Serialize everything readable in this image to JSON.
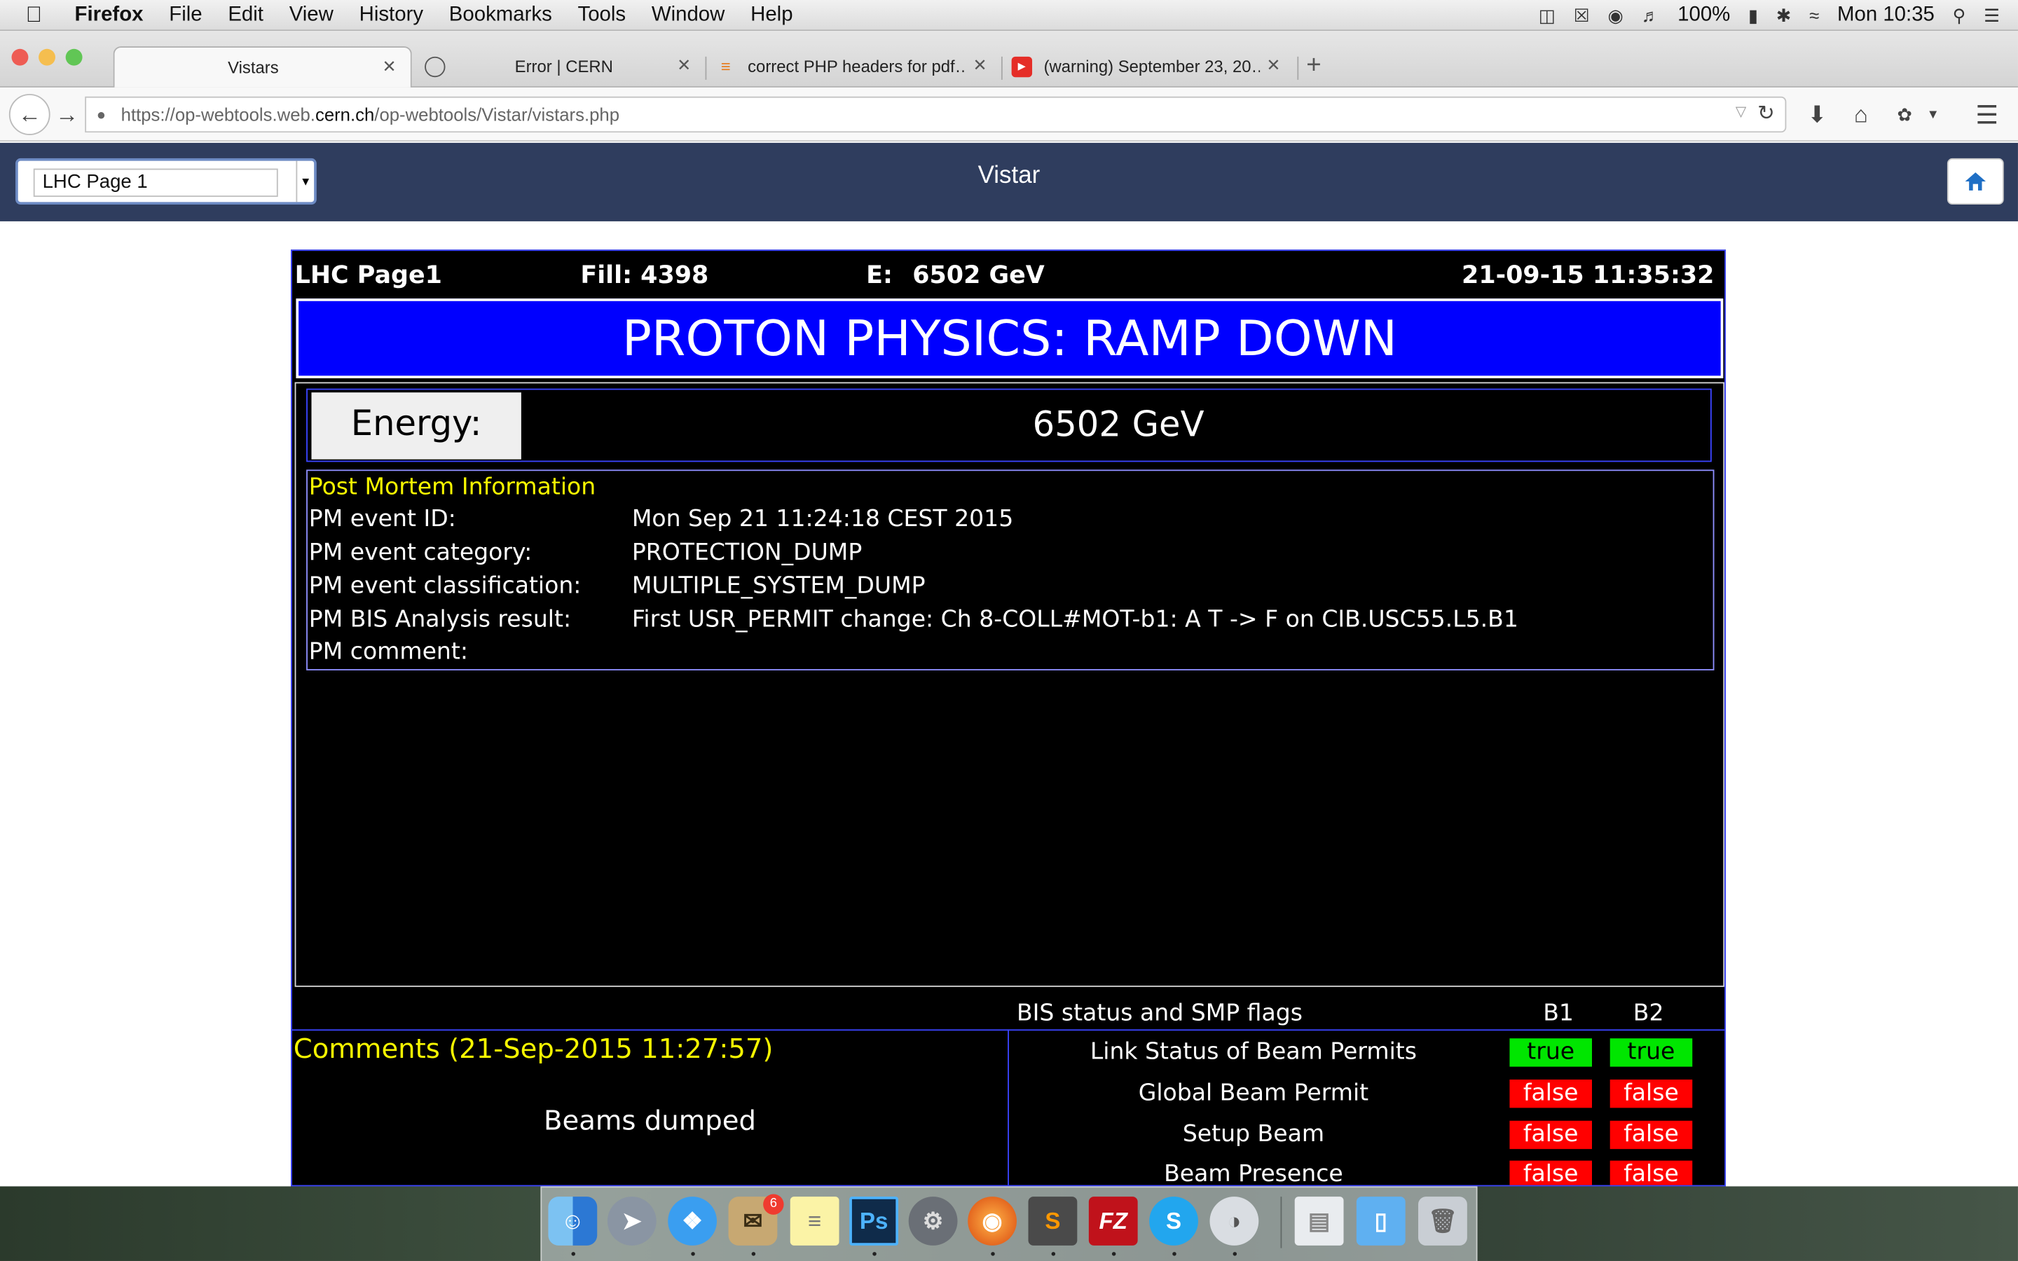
{
  "menubar": {
    "app": "Firefox",
    "items": [
      "File",
      "Edit",
      "View",
      "History",
      "Bookmarks",
      "Tools",
      "Window",
      "Help"
    ],
    "battery": "100%",
    "clock": "Mon 10:35"
  },
  "tabs": [
    {
      "label": "Vistars",
      "active": true
    },
    {
      "label": "Error | CERN",
      "active": false
    },
    {
      "label": "correct PHP headers for pdf…",
      "active": false
    },
    {
      "label": "(warning) September 23, 20…",
      "active": false
    }
  ],
  "url": {
    "prefix": "https://op-webtools.web.",
    "domain": "cern.ch",
    "path": "/op-webtools/Vistar/vistars.php"
  },
  "vistar": {
    "select_value": "LHC Page 1",
    "title": "Vistar"
  },
  "page": {
    "header": {
      "page": "LHC Page1",
      "fill": "Fill: 4398",
      "energy_label": "E:",
      "energy": "6502 GeV",
      "timestamp": "21-09-15 11:35:32"
    },
    "banner": "PROTON PHYSICS: RAMP DOWN",
    "energy_label": "Energy:",
    "energy_value": "6502 GeV",
    "pm": {
      "title": "Post Mortem Information",
      "rows": [
        {
          "label": "PM event ID:",
          "value": "Mon Sep 21 11:24:18 CEST 2015"
        },
        {
          "label": "PM event category:",
          "value": "PROTECTION_DUMP"
        },
        {
          "label": "PM event classification:",
          "value": "MULTIPLE_SYSTEM_DUMP"
        },
        {
          "label": "PM BIS Analysis result:",
          "value": "First USR_PERMIT change: Ch 8-COLL#MOT-b1: A T -> F on CIB.USC55.L5.B1"
        },
        {
          "label": "PM comment:",
          "value": ""
        }
      ]
    },
    "bis": {
      "title": "BIS status and SMP flags",
      "col_b1": "B1",
      "col_b2": "B2",
      "rows": [
        {
          "label": "Link Status of Beam Permits",
          "b1": "true",
          "b2": "true"
        },
        {
          "label": "Global Beam Permit",
          "b1": "false",
          "b2": "false"
        },
        {
          "label": "Setup Beam",
          "b1": "false",
          "b2": "false"
        },
        {
          "label": "Beam Presence",
          "b1": "false",
          "b2": "false"
        }
      ]
    },
    "comments": {
      "title": "Comments (21-Sep-2015 11:27:57)",
      "text": "Beams dumped"
    }
  },
  "dock": {
    "apps": [
      "finder-icon",
      "launchpad-icon",
      "safari-icon",
      "mail-icon",
      "notes-icon",
      "photoshop-icon",
      "system-preferences-icon",
      "firefox-icon",
      "sublime-icon",
      "filezilla-icon",
      "skype-icon",
      "sequel-pro-icon",
      "documents-icon",
      "folder-icon",
      "trash-icon"
    ],
    "mail_badge": "6",
    "photoshop_label": "Ps"
  }
}
